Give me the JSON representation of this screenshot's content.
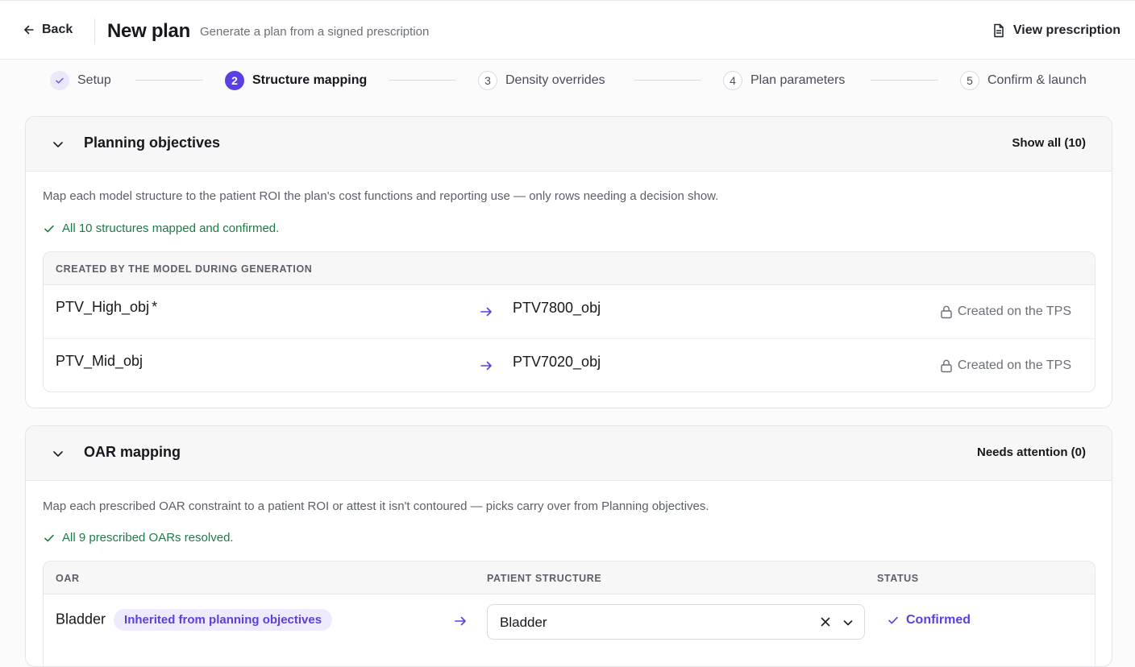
{
  "header": {
    "back_label": "Back",
    "title": "New plan",
    "subtitle": "Generate a plan from a signed prescription",
    "view_prescription_label": "View prescription"
  },
  "stepper": [
    {
      "num": "",
      "label": "Setup",
      "state": "done"
    },
    {
      "num": "2",
      "label": "Structure mapping",
      "state": "active"
    },
    {
      "num": "3",
      "label": "Density overrides",
      "state": "pending"
    },
    {
      "num": "4",
      "label": "Plan parameters",
      "state": "pending"
    },
    {
      "num": "5",
      "label": "Confirm & launch",
      "state": "pending"
    }
  ],
  "planning": {
    "title": "Planning objectives",
    "action": "Show all (10)",
    "description": "Map each model structure to the patient ROI the plan's cost functions and reporting use — only rows needing a decision show.",
    "status": "All 10 structures mapped and confirmed.",
    "table_header": "CREATED BY THE MODEL DURING GENERATION",
    "rows": [
      {
        "source": "PTV_High_obj",
        "marker": "*",
        "target": "PTV7800_obj",
        "note": "Created on the TPS"
      },
      {
        "source": "PTV_Mid_obj",
        "marker": "",
        "target": "PTV7020_obj",
        "note": "Created on the TPS"
      }
    ]
  },
  "oar": {
    "title": "OAR mapping",
    "action": "Needs attention (0)",
    "description": "Map each prescribed OAR constraint to a patient ROI or attest it isn't contoured — picks carry over from Planning objectives.",
    "status": "All 9 prescribed OARs resolved.",
    "columns": {
      "oar": "OAR",
      "patient_structure": "PATIENT STRUCTURE",
      "status": "STATUS"
    },
    "rows": [
      {
        "oar": "Bladder",
        "badge": "Inherited from planning objectives",
        "structure": "Bladder",
        "status": "Confirmed"
      }
    ]
  },
  "colors": {
    "accent": "#5b3fe0",
    "success": "#1f7a45"
  }
}
